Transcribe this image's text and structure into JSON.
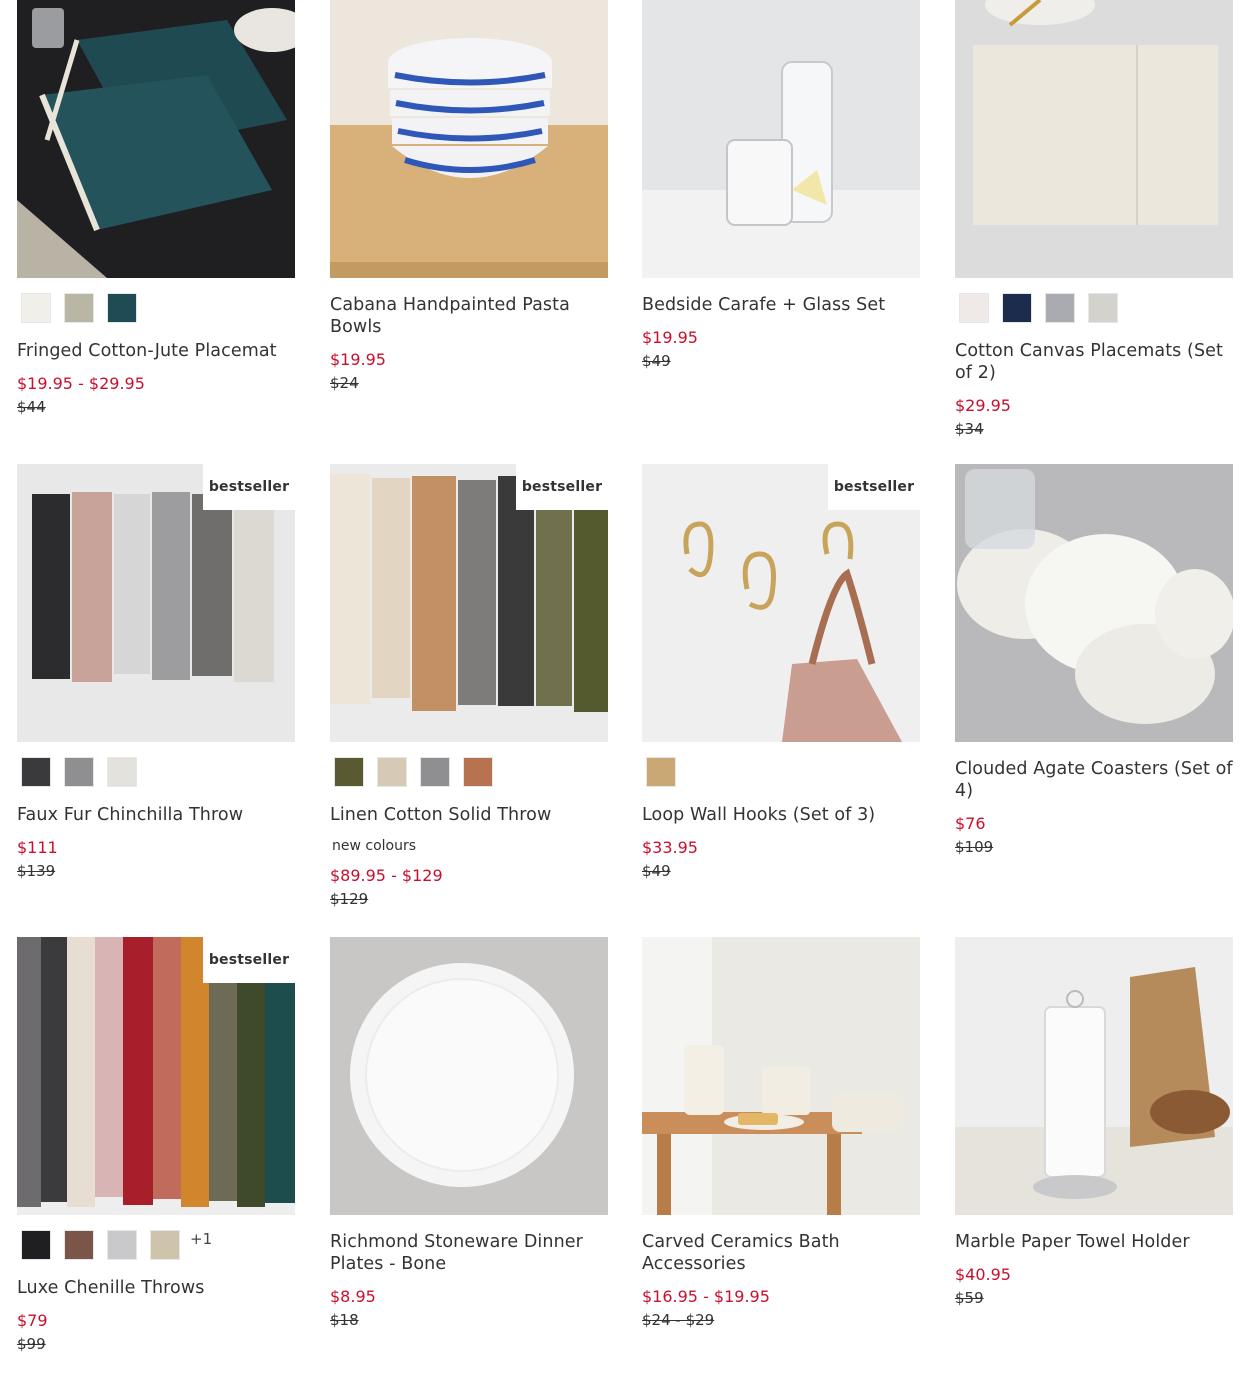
{
  "badge_text": "bestseller",
  "colors": {
    "sale_price": "#c8102e",
    "text": "#333333"
  },
  "products": [
    {
      "name": "Fringed Cotton-Jute Placemat",
      "sale_price": "$19.95 - $29.95",
      "original_price": "$44",
      "swatches": [
        "#f1efe9",
        "#b9b6a5",
        "#1f4b55"
      ]
    },
    {
      "name": "Cabana Handpainted Pasta Bowls",
      "sale_price": "$19.95",
      "original_price": "$24"
    },
    {
      "name": "Bedside Carafe + Glass Set",
      "sale_price": "$19.95",
      "original_price": "$49"
    },
    {
      "name": "Cotton Canvas Placemats (Set of 2)",
      "sale_price": "$29.95",
      "original_price": "$34",
      "swatches": [
        "#efe9e7",
        "#1c2c4c",
        "#a9abb0",
        "#d3d2cd"
      ]
    },
    {
      "name": "Faux Fur Chinchilla Throw",
      "sale_price": "$111",
      "original_price": "$139",
      "bestseller": true,
      "swatches": [
        "#3a3a3c",
        "#8f8f91",
        "#e4e2dc"
      ]
    },
    {
      "name": "Linen Cotton Solid Throw",
      "note": "new colours",
      "sale_price": "$89.95 - $129",
      "original_price": "$129",
      "bestseller": true,
      "swatches": [
        "#5a5a32",
        "#d6c9b6",
        "#8f8f92",
        "#b77350"
      ]
    },
    {
      "name": "Loop Wall Hooks (Set of 3)",
      "sale_price": "$33.95",
      "original_price": "$49",
      "bestseller": true,
      "swatches": [
        "#c9a876"
      ]
    },
    {
      "name": "Clouded Agate Coasters (Set of 4)",
      "sale_price": "$76",
      "original_price": "$109"
    },
    {
      "name": "Luxe Chenille Throws",
      "sale_price": "$79",
      "original_price": "$99",
      "bestseller": true,
      "swatches": [
        "#1f1f21",
        "#7b5548",
        "#c9c9cc",
        "#cdc4ab"
      ],
      "more_colors": "+1"
    },
    {
      "name": "Richmond Stoneware Dinner Plates - Bone",
      "sale_price": "$8.95",
      "original_price": "$18"
    },
    {
      "name": "Carved Ceramics Bath Accessories",
      "sale_price": "$16.95 - $19.95",
      "original_price": "$24 - $29"
    },
    {
      "name": "Marble Paper Towel Holder",
      "sale_price": "$40.95",
      "original_price": "$59"
    }
  ]
}
